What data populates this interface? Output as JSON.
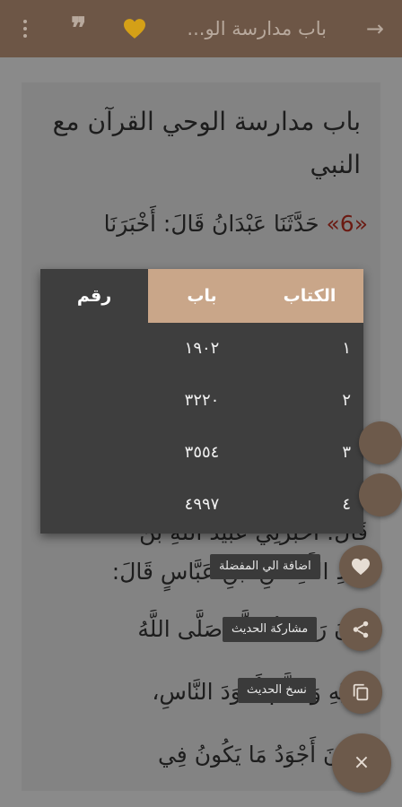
{
  "topbar": {
    "title": "باب مدارسة الو...",
    "back_icon": "arrow-back-icon",
    "favorite_icon": "heart-icon",
    "quote_icon": "quote-icon",
    "menu_icon": "more-vert-icon",
    "accent_color": "#d4a017"
  },
  "content": {
    "chapter_title": "باب مدارسة الوحي القرآن مع النبي",
    "hadith_number": "«6»",
    "lines": [
      " حَدَّثَنَا عَبْدَانُ قَالَ: أَخْبَرَنَا",
      "قَالَ: أَخْبَرَنِي عُبَيْدُ اللَّهِ بْنُ",
      "عَبْدِ اللَّهِ عَنِ ابْنِ عَبَّاسٍ قَالَ:",
      "كَانَ رَسُولُ اللَّهِ صَلَّى اللَّهُ",
      "عَلَيْهِ وَسَلَّمَ أَجْوَدَ النَّاسِ،",
      "وَكَانَ أَجْوَدُ مَا يَكُونُ فِي"
    ]
  },
  "table": {
    "headers": {
      "kitab": "الكتاب",
      "bab": "باب",
      "raqm": "رقم"
    },
    "rows": [
      {
        "kitab": "١",
        "bab": "١٩٠٢"
      },
      {
        "kitab": "٢",
        "bab": "٣٢٢٠"
      },
      {
        "kitab": "٣",
        "bab": "٣٥٥٤"
      },
      {
        "kitab": "٤",
        "bab": "٤٩٩٧"
      }
    ]
  },
  "fab": {
    "favorite_label": "اضافة الي المفضلة",
    "share_label": "مشاركة الحديث",
    "copy_label": "نسخ الحديث",
    "close_symbol": "×"
  }
}
